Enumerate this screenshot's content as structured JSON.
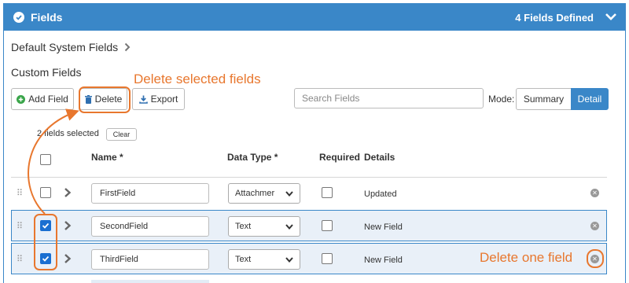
{
  "header": {
    "title": "Fields",
    "count_text": "4 Fields Defined"
  },
  "default_system_fields_label": "Default System Fields",
  "custom_fields_label": "Custom Fields",
  "toolbar": {
    "add_field_label": "Add Field",
    "delete_label": "Delete",
    "export_label": "Export",
    "search_placeholder": "Search Fields",
    "mode_label": "Mode:",
    "mode_summary_label": "Summary",
    "mode_detail_label": "Detail",
    "active_mode": "Detail"
  },
  "selection": {
    "text": "2 fields selected",
    "clear_label": "Clear"
  },
  "columns": {
    "name": "Name *",
    "data_type": "Data Type *",
    "required": "Required",
    "details": "Details"
  },
  "rows": [
    {
      "name": "FirstField",
      "type": "Attachmer",
      "details": "Updated",
      "selected": false,
      "required": false
    },
    {
      "name": "SecondField",
      "type": "Text",
      "details": "New Field",
      "selected": true,
      "required": false
    },
    {
      "name": "ThirdField",
      "type": "Text",
      "details": "New Field",
      "selected": true,
      "required": false
    }
  ],
  "annotations": {
    "delete_selected": "Delete selected fields",
    "delete_one": "Delete one field"
  },
  "colors": {
    "primary": "#3a87c8",
    "accent_annotation": "#e8772e",
    "checkbox_checked": "#1a6fd1"
  }
}
